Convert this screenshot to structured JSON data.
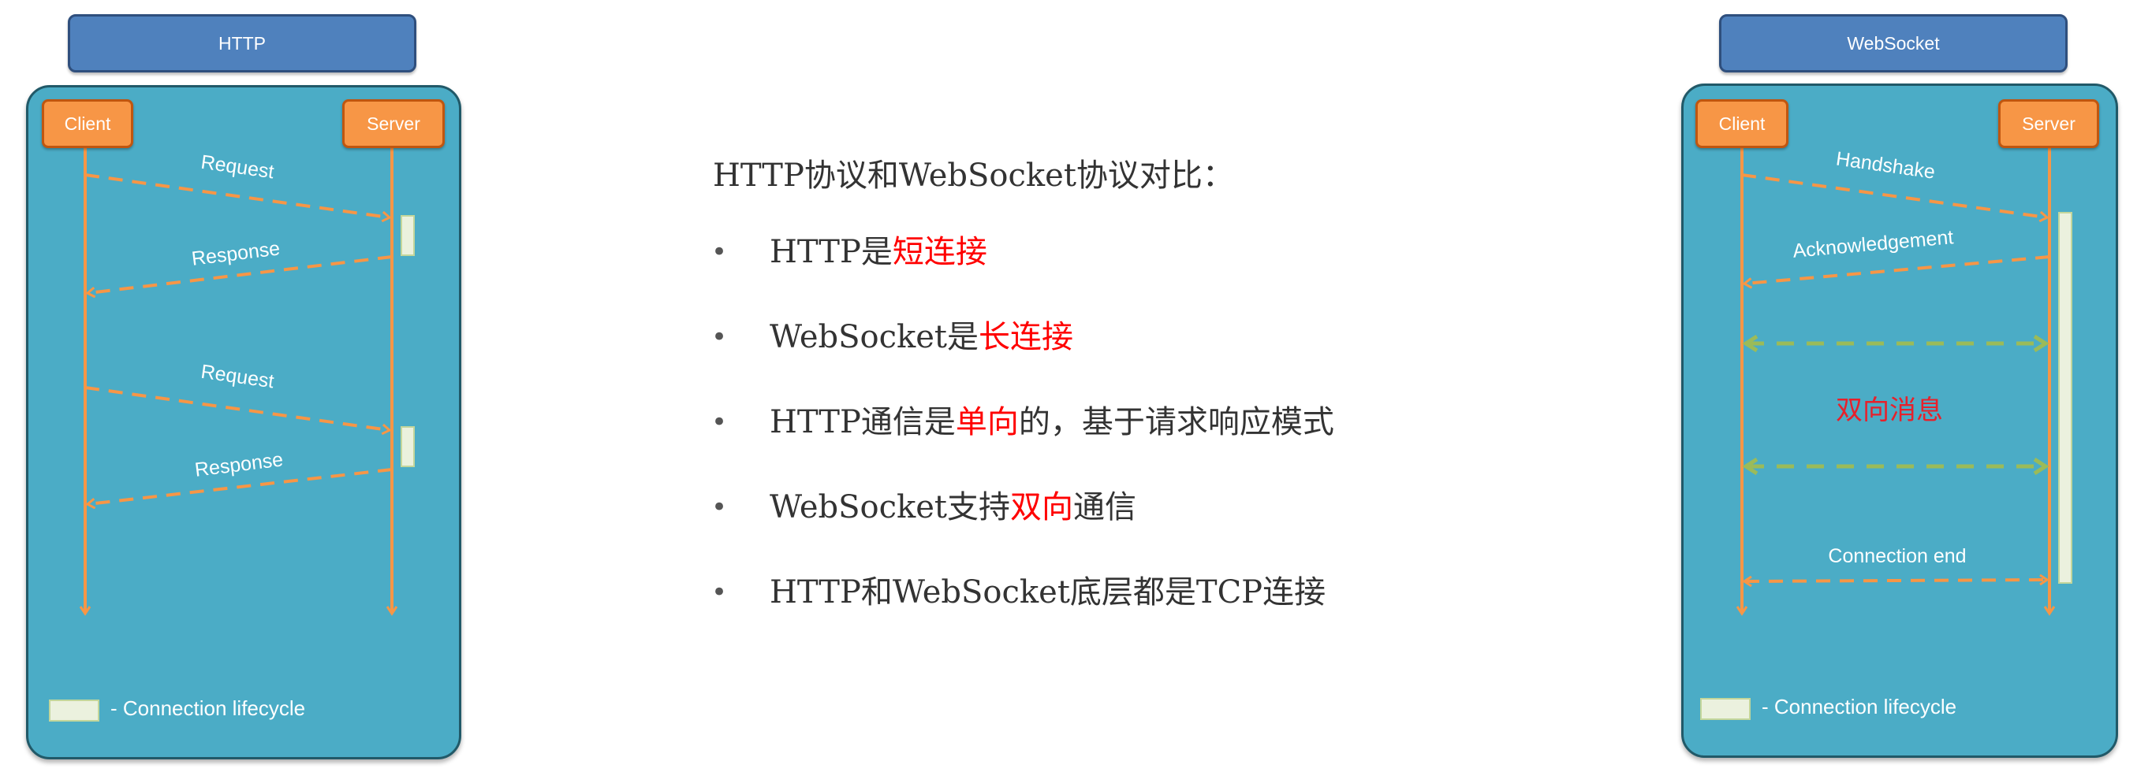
{
  "http_diagram": {
    "title": "HTTP",
    "client_label": "Client",
    "server_label": "Server",
    "messages": [
      "Request",
      "Response",
      "Request",
      "Response"
    ],
    "legend": "- Connection lifecycle"
  },
  "websocket_diagram": {
    "title": "WebSocket",
    "client_label": "Client",
    "server_label": "Server",
    "messages": [
      "Handshake",
      "Acknowledgement"
    ],
    "middle_label": "双向消息",
    "end_label": "Connection end",
    "legend": "- Connection lifecycle"
  },
  "comparison": {
    "heading": "HTTP协议和WebSocket协议对比：",
    "bullet_symbol": "•",
    "items": [
      {
        "pre": "HTTP是",
        "highlight": "短连接",
        "post": ""
      },
      {
        "pre": "WebSocket是",
        "highlight": "长连接",
        "post": ""
      },
      {
        "pre": "HTTP通信是",
        "highlight": "单向",
        "post": "的，基于请求响应模式"
      },
      {
        "pre": "WebSocket支持",
        "highlight": "双向",
        "post": "通信"
      },
      {
        "pre": "HTTP和WebSocket底层都是TCP连接",
        "highlight": "",
        "post": ""
      }
    ]
  },
  "colors": {
    "panel": "#4bacc6",
    "node": "#f79646",
    "title_box": "#4f81bd",
    "lifecycle": "#ebf1de",
    "bidirectional_arrow": "#9bbb59",
    "highlight": "#ff0000"
  }
}
